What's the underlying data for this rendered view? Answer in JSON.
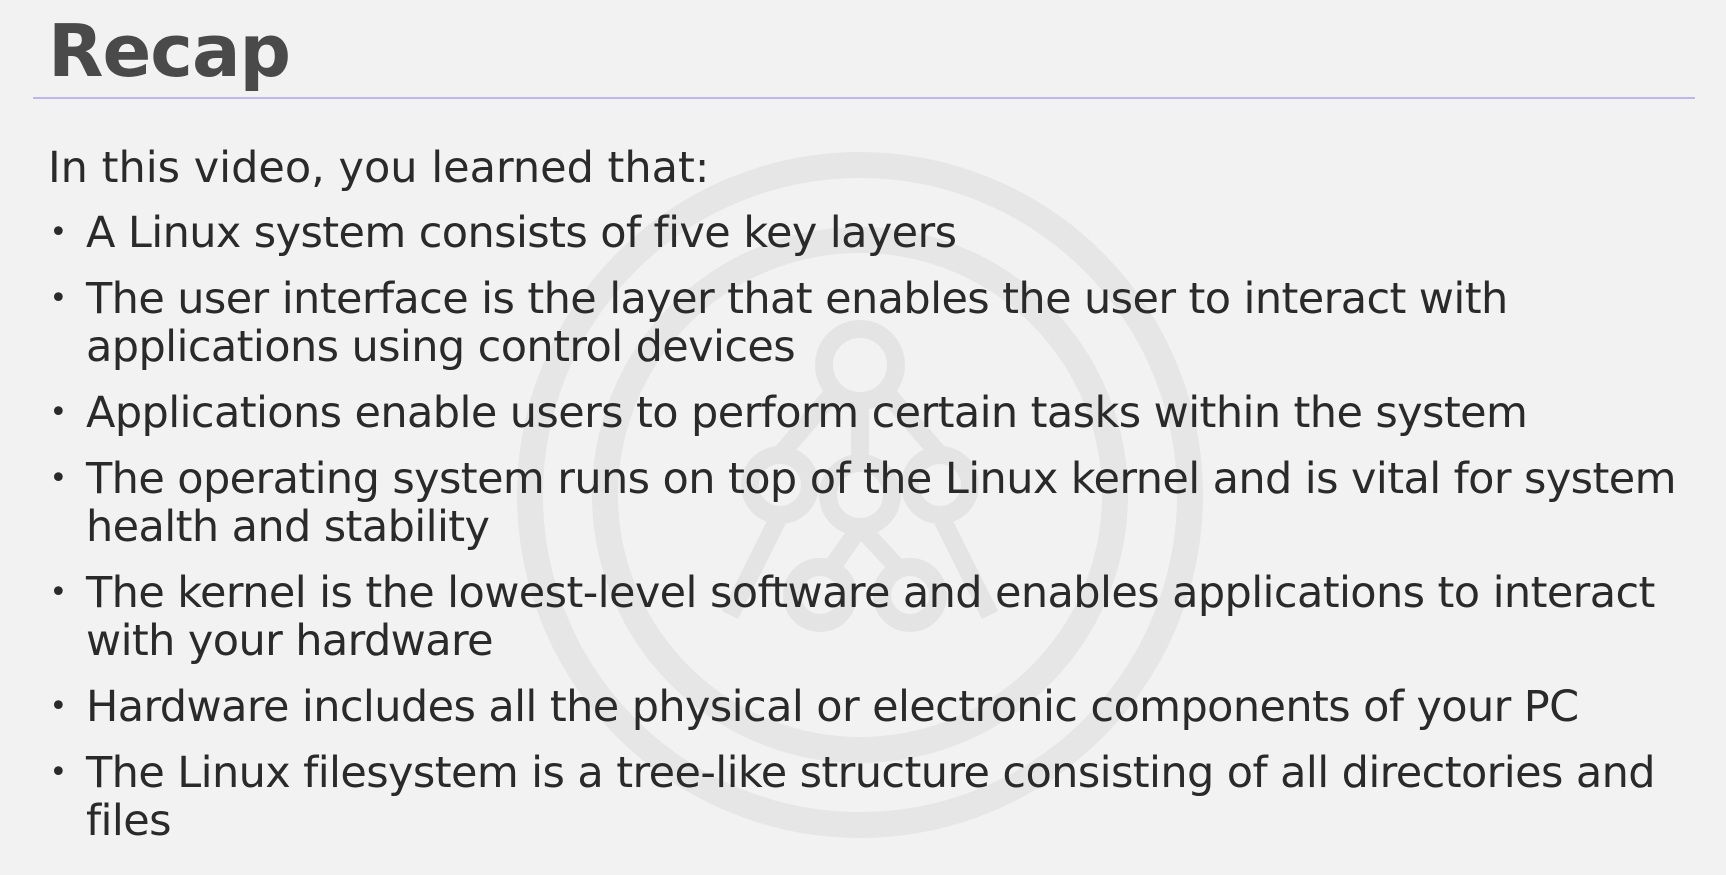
{
  "slide": {
    "title": "Recap",
    "intro": "In this video, you learned that:",
    "bullet_symbol": "•",
    "points": [
      "A Linux system consists of five key layers",
      "The user interface is the layer that enables the user to interact with applications using control devices",
      "Applications enable users to perform certain tasks within the system",
      "The operating system runs on top of the Linux kernel and is vital for system health and stability",
      "The kernel is the lowest-level software and enables applications to interact with your hardware",
      "Hardware includes all the physical or electronic components of your PC",
      "The Linux filesystem is a tree-like structure consisting of all directories and files"
    ]
  },
  "colors": {
    "background": "#f2f2f2",
    "title": "#4a4a4a",
    "text": "#2a2a2a",
    "divider": "#bcb8ef"
  },
  "watermark": {
    "icon": "watermark-logo-icon"
  }
}
